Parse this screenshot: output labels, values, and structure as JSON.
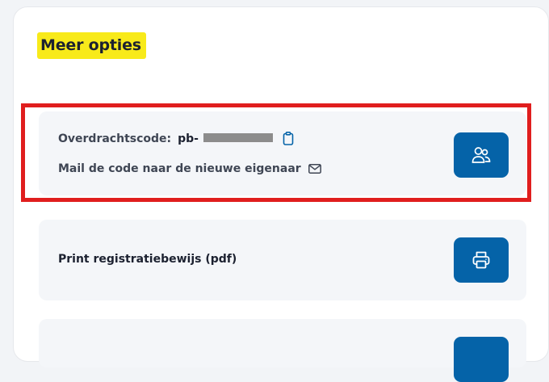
{
  "section": {
    "title": "Meer opties"
  },
  "transfer": {
    "code_label": "Overdrachtscode:",
    "code_prefix": "pb-",
    "mail_label": "Mail de code naar de nieuwe eigenaar",
    "copy_icon": "clipboard-icon",
    "mail_icon": "envelope-icon",
    "button_icon": "users-icon"
  },
  "print": {
    "label": "Print registratiebewijs (pdf)",
    "button_icon": "printer-icon"
  },
  "colors": {
    "primary": "#0563a8",
    "highlight_marker": "#f8ea1a",
    "annotation_border": "#e01e1e",
    "card_background": "#f4f6f9"
  }
}
